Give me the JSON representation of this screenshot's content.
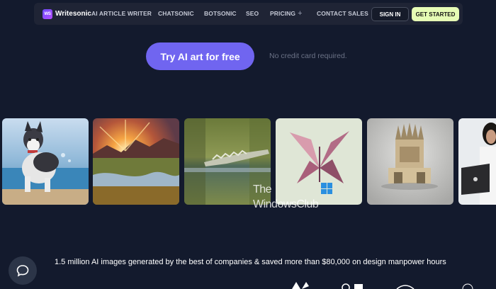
{
  "nav": {
    "brand": "Writesonic",
    "brand_mark": "WS",
    "links": [
      "AI ARTICLE WRITER",
      "CHATSONIC",
      "BOTSONIC",
      "SEO",
      "PRICING",
      "CONTACT SALES"
    ],
    "pricing_toggle_icon": "plus-icon",
    "signin_label": "SIGN IN",
    "get_started_label": "GET STARTED"
  },
  "hero": {
    "cta_label": "Try AI art for free",
    "no_card_text": "No credit card required."
  },
  "gallery": {
    "images": [
      {
        "name": "husky-beach-image"
      },
      {
        "name": "sunset-valley-image"
      },
      {
        "name": "crocodile-water-image"
      },
      {
        "name": "origami-butterfly-image"
      },
      {
        "name": "clay-throne-image"
      },
      {
        "name": "person-laptop-image"
      }
    ]
  },
  "watermark": {
    "line1": "The",
    "line2": "WindowsClub"
  },
  "stats_text": "1.5 million AI images generated by the best of companies & saved more than $80,000 on design manpower hours",
  "chat_icon": "chat-bubble-icon",
  "colors": {
    "background": "#131a2d",
    "nav_bg": "#1f2435",
    "cta": "#7065f0",
    "get_started": "#e6fcb5"
  }
}
